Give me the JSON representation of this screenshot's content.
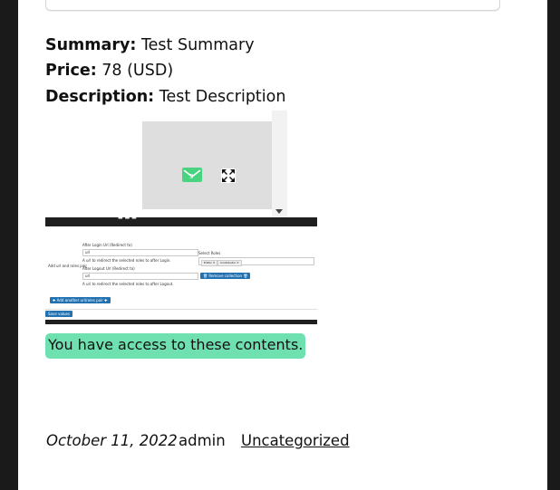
{
  "post": {
    "summary_label": "Summary:",
    "summary_value": " Test Summary",
    "price_label": "Price:",
    "price_value": " 78 (USD)",
    "description_label": "Description:",
    "description_value": " Test Description"
  },
  "preview": {
    "mail_icon": "mail-icon",
    "expand_icon": "expand-icon",
    "scroll_arrow_icon": "chevron-down-icon"
  },
  "screenshot": {
    "after_login_label": "After Login Url (Redirect to)",
    "after_login_help": "A url to redirect the selected roles to after Login.",
    "select_roles_label": "Select Roles",
    "role_chip_1": "Editor ✕",
    "role_chip_2": "Contributor ✕",
    "row_label": "Add url and roles pair",
    "after_logout_label": "After Logout Url (Redirect to)",
    "after_logout_help": "A url to redirect the selected roles to after Logout.",
    "input_placeholder": "url",
    "remove_button": "🗑 Remove collection 🗑",
    "add_button": "✚ Add another url/roles pair ✚",
    "save_button": "Save values"
  },
  "access_message": "You have access to these contents.",
  "footer_meta": {
    "date": "October 11, 2022",
    "author": "admin",
    "category": "Uncategorized"
  },
  "colors": {
    "access_bg": "#6fe0b0",
    "mail_green": "#47d37f",
    "button_blue": "#2271b1",
    "frame_dark": "#1a1a1a"
  }
}
